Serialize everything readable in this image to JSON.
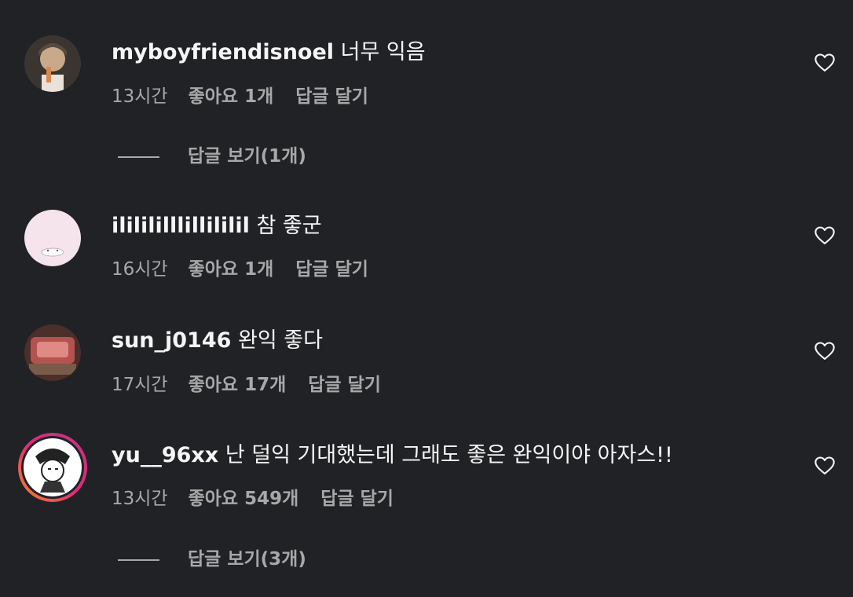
{
  "comments": [
    {
      "username": "myboyfriendisnoel",
      "text": "너무 익음",
      "time": "13시간",
      "likes": "좋아요 1개",
      "reply": "답글 달기",
      "view_replies": "답글 보기(1개)",
      "avatar": "photo-avatar"
    },
    {
      "username": "ililililllillililil",
      "text": "참 좋군",
      "time": "16시간",
      "likes": "좋아요 1개",
      "reply": "답글 달기",
      "avatar": "pink-avatar"
    },
    {
      "username": "sun_j0146",
      "text": "완익 좋다",
      "time": "17시간",
      "likes": "좋아요 17개",
      "reply": "답글 달기",
      "avatar": "photo-avatar"
    },
    {
      "username": "yu__96xx",
      "text": "난 덜익 기대했는데 그래도 좋은 완익이야 아자스!!",
      "time": "13시간",
      "likes": "좋아요 549개",
      "reply": "답글 달기",
      "view_replies": "답글 보기(3개)",
      "avatar": "story-ring-avatar"
    }
  ],
  "icons": {
    "like": "heart-outline-icon"
  },
  "colors": {
    "background": "#212226",
    "primary_text": "#f5f5f5",
    "secondary_text": "#a8a8a8",
    "story_ring_start": "#f58529",
    "story_ring_end": "#c13584"
  }
}
